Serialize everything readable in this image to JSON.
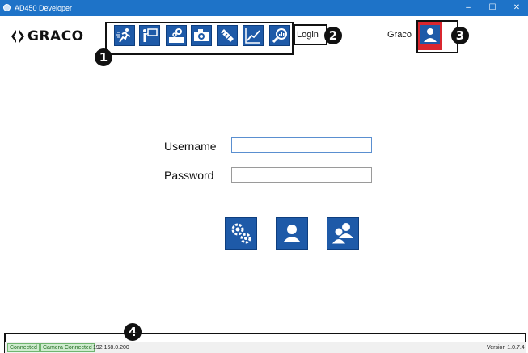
{
  "window": {
    "title": "AD450 Developer",
    "controls": [
      "–",
      "☐",
      "✕"
    ]
  },
  "brand": {
    "logo_text": "GRACO"
  },
  "toolbar": {
    "buttons": [
      {
        "icon": "running-person-icon"
      },
      {
        "icon": "presenter-icon"
      },
      {
        "icon": "machine-gears-icon"
      },
      {
        "icon": "camera-icon"
      },
      {
        "icon": "calibration-icon"
      },
      {
        "icon": "line-chart-icon"
      },
      {
        "icon": "magnify-report-icon"
      }
    ],
    "login_label": "Login"
  },
  "user": {
    "name": "Graco",
    "icon": "user-icon"
  },
  "callouts": [
    "1",
    "2",
    "3",
    "4"
  ],
  "login_form": {
    "username_label": "Username",
    "username_value": "",
    "password_label": "Password",
    "password_value": ""
  },
  "actions": [
    {
      "icon": "settings-gears-icon"
    },
    {
      "icon": "user-icon"
    },
    {
      "icon": "users-icon"
    }
  ],
  "status": {
    "connected": "Connected",
    "camera": "Camera Connected",
    "ip": "192.168.0.200",
    "version": "Version 1.0.7.4"
  },
  "colors": {
    "titlebar": "#1e73c8",
    "button_blue": "#1e5aa8",
    "active_user_red": "#d9262f",
    "status_green": "#cfeccf"
  }
}
